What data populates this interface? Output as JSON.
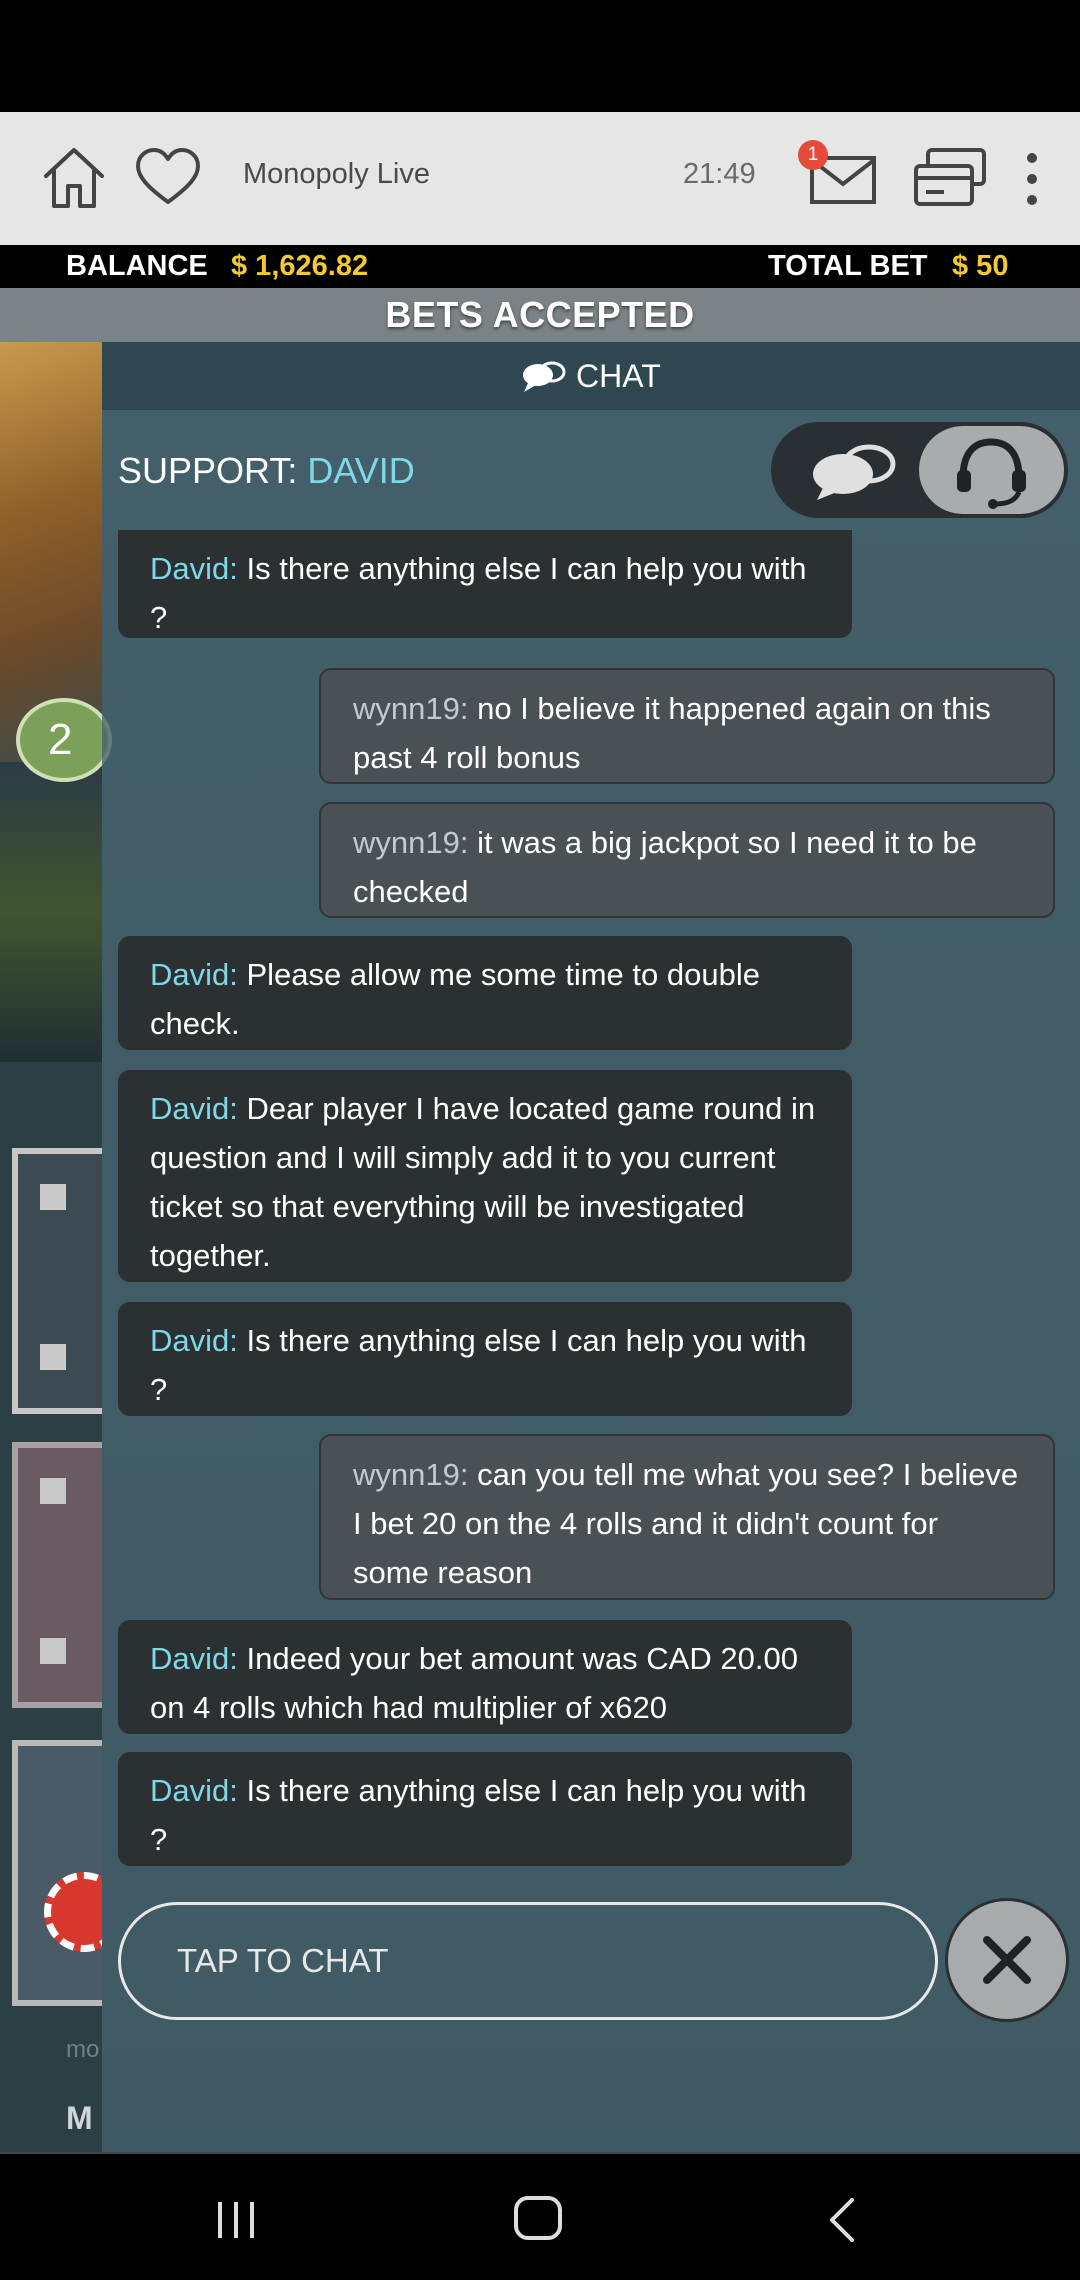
{
  "app_bar": {
    "title": "Monopoly Live",
    "time": "21:49",
    "mail_badge": "1",
    "icons": [
      "home-icon",
      "heart-icon",
      "mail-icon",
      "cashier-icon",
      "more-vertical-icon"
    ]
  },
  "balance_bar": {
    "balance_label": "BALANCE",
    "balance_value": "$ 1,626.82",
    "total_bet_label": "TOTAL BET",
    "total_bet_value": "$ 50"
  },
  "game": {
    "status_banner": "BETS ACCEPTED",
    "round_badge": "2",
    "footer_small": "mo",
    "footer_title": "M"
  },
  "chat": {
    "header_title": "CHAT",
    "support_label": "SUPPORT:",
    "support_agent": "DAVID",
    "messages": [
      {
        "sender": "David:",
        "text": " Is there anything else I can help you with ?"
      },
      {
        "sender": "wynn19:",
        "text": " no I believe it happened again on this past 4 roll bonus"
      },
      {
        "sender": "wynn19:",
        "text": " it was a big jackpot so I need it to be checked"
      },
      {
        "sender": "David:",
        "text": " Please allow me some time to double check."
      },
      {
        "sender": "David:",
        "text": " Dear player I have located game round in question and I will simply add it to you current ticket so that everything will be investigated together."
      },
      {
        "sender": "David:",
        "text": " Is there anything else I can help you with ?"
      },
      {
        "sender": "wynn19:",
        "text": " can you tell me what you see? I believe I bet 20 on the 4 rolls and it didn't count for some reason"
      },
      {
        "sender": "David:",
        "text": " Indeed your bet amount was CAD 20.00 on 4 rolls which had multiplier of x620"
      },
      {
        "sender": "David:",
        "text": " Is there anything else I can help you with ?"
      }
    ],
    "input_placeholder": "TAP TO CHAT"
  },
  "colors": {
    "accent_cyan": "#7fd8e6",
    "balance_gold": "#f3c934",
    "badge_red": "#e34b3b"
  }
}
